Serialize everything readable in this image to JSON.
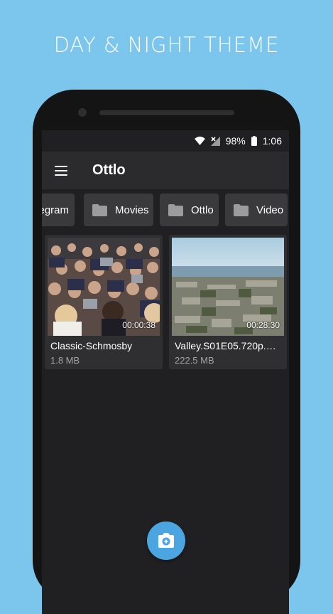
{
  "banner": {
    "headline": "DAY & NIGHT THEME"
  },
  "status_bar": {
    "battery_percent": "98%",
    "time": "1:06"
  },
  "app_bar": {
    "title": "Ottlo",
    "menu_icon": "hamburger-menu-icon"
  },
  "folders": [
    {
      "label": "legram",
      "icon": "folder-icon"
    },
    {
      "label": "Movies",
      "icon": "folder-icon"
    },
    {
      "label": "Ottlo",
      "icon": "folder-icon"
    },
    {
      "label": "Video",
      "icon": "folder-icon"
    }
  ],
  "videos": [
    {
      "name": "Classic-Schmosby",
      "size": "1.8 MB",
      "duration": "00:00:38"
    },
    {
      "name": "Valley.S01E05.720p.5....",
      "size": "222.5 MB",
      "duration": "00:28:30"
    }
  ],
  "fab": {
    "icon": "camera-icon"
  },
  "colors": {
    "background": "#7cc6ee",
    "screen": "#202022",
    "appbar": "#2b2b2d",
    "card": "#2f2f31",
    "accent": "#4aa5e1"
  }
}
